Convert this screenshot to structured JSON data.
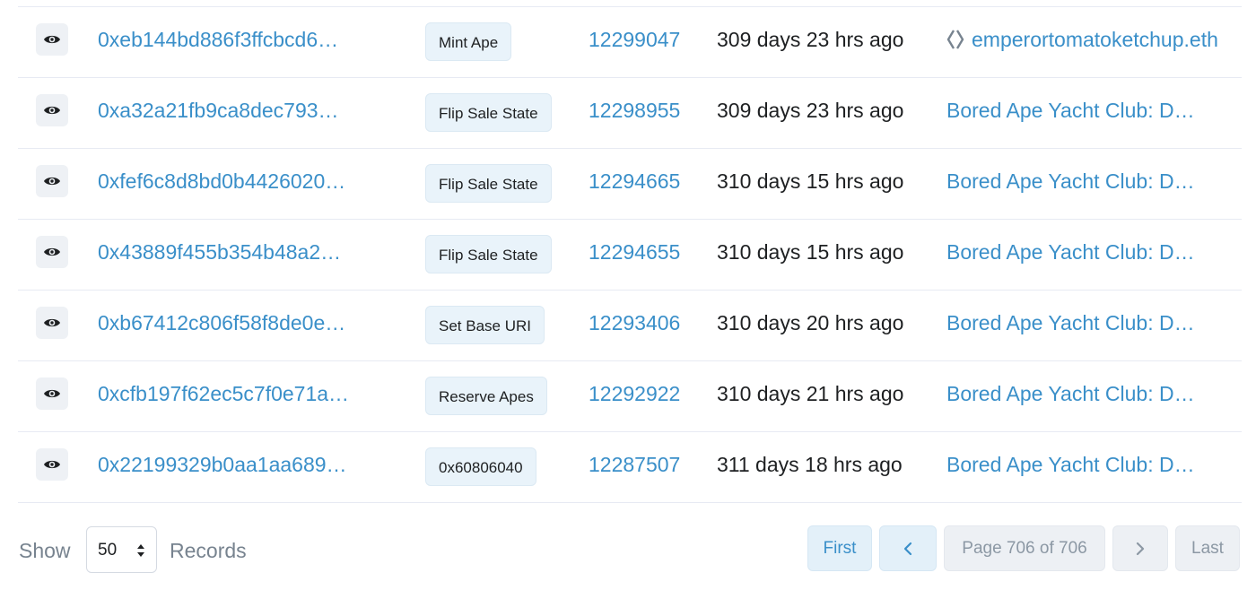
{
  "transactions": [
    {
      "hash": "0xeb144bd886f3ffcbcd6…",
      "method": "Mint Ape",
      "block": "12299047",
      "age": "309 days 23 hrs ago",
      "from": "emperortomatoketchup.eth",
      "from_icon": "ens-diamond-icon"
    },
    {
      "hash": "0xa32a21fb9ca8dec793…",
      "method": "Flip Sale State",
      "block": "12298955",
      "age": "309 days 23 hrs ago",
      "from": "Bored Ape Yacht Club: D…",
      "from_icon": ""
    },
    {
      "hash": "0xfef6c8d8bd0b4426020…",
      "method": "Flip Sale State",
      "block": "12294665",
      "age": "310 days 15 hrs ago",
      "from": "Bored Ape Yacht Club: D…",
      "from_icon": ""
    },
    {
      "hash": "0x43889f455b354b48a2…",
      "method": "Flip Sale State",
      "block": "12294655",
      "age": "310 days 15 hrs ago",
      "from": "Bored Ape Yacht Club: D…",
      "from_icon": ""
    },
    {
      "hash": "0xb67412c806f58f8de0e…",
      "method": "Set Base URI",
      "block": "12293406",
      "age": "310 days 20 hrs ago",
      "from": "Bored Ape Yacht Club: D…",
      "from_icon": ""
    },
    {
      "hash": "0xcfb197f62ec5c7f0e71a…",
      "method": "Reserve Apes",
      "block": "12292922",
      "age": "310 days 21 hrs ago",
      "from": "Bored Ape Yacht Club: D…",
      "from_icon": ""
    },
    {
      "hash": "0x22199329b0aa1aa689…",
      "method": "0x60806040",
      "block": "12287507",
      "age": "311 days 18 hrs ago",
      "from": "Bored Ape Yacht Club: D…",
      "from_icon": ""
    }
  ],
  "footer": {
    "show_label": "Show",
    "records_value": "50",
    "records_label": "Records"
  },
  "pagination": {
    "first": "First",
    "prev": "‹",
    "info": "Page 706 of 706",
    "next": "›",
    "last": "Last"
  },
  "colors": {
    "link": "#3a8fc9",
    "text": "#1e2022",
    "muted": "#77838f",
    "badge_bg": "#e9f3fa",
    "divider": "#e7eaf3"
  }
}
